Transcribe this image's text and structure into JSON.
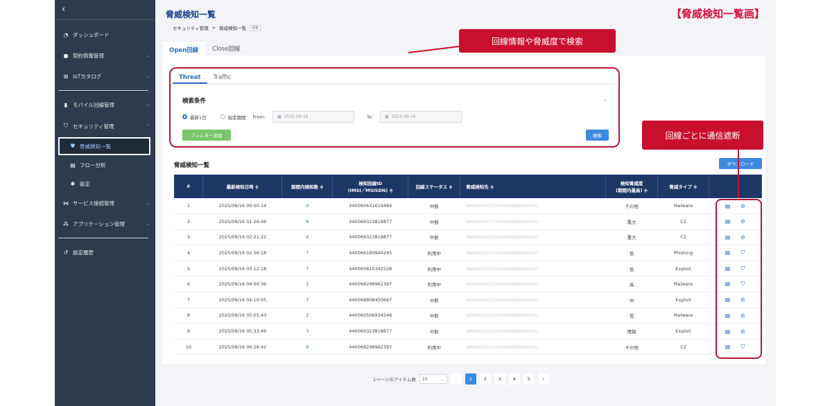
{
  "corner_title": "【脅威検知一覧画】",
  "callouts": {
    "search": "回線情報や脅威度で検索",
    "block": "回線ごとに通信遮断"
  },
  "sidebar": {
    "back": "‹",
    "items": [
      {
        "label": "ダッシュボード"
      },
      {
        "label": "契約情報管理"
      },
      {
        "label": "IoTカタログ"
      },
      {
        "label": "モバイル回線管理"
      },
      {
        "label": "セキュリティ管理"
      },
      {
        "label": "脅威検知一覧"
      },
      {
        "label": "フロー分析"
      },
      {
        "label": "設定"
      },
      {
        "label": "サービス接続管理"
      },
      {
        "label": "アプリケーション管理"
      },
      {
        "label": "設定履歴"
      }
    ]
  },
  "page": {
    "title": "脅威検知一覧",
    "breadcrumb": [
      "セキュリティ管理",
      ">",
      "脅威検知一覧"
    ],
    "breadcrumb_tag": "閲覧",
    "tabs": [
      "Open回線",
      "Close回線"
    ]
  },
  "search": {
    "tabs": [
      "Threat",
      "Traffic"
    ],
    "title": "検索条件",
    "radio1": "最新1日",
    "radio2": "指定期間",
    "from_label": "From:",
    "from_value": "2025-09-16",
    "to_label": "To:",
    "to_value": "2025-09-16",
    "filter_button": "フィルター追加",
    "search_button": "検索"
  },
  "list": {
    "title": "脅威検知一覧",
    "download": "ダウンロード",
    "headers": [
      "#",
      "最新検知日時 ≑",
      "期間内検知数 ≑",
      "検知回線ID\n(IMSI／MSISDN) ≑",
      "回線ステータス ≑",
      "脅威検知先 ≑",
      "検知脅威度\n(期間内最高) ≑",
      "脅威タイプ ≑",
      ""
    ],
    "rows": [
      {
        "no": "1",
        "time": "2025/09/16 00:50:14",
        "count": "0",
        "id": "440060631619484",
        "status": "中断",
        "level": "その他",
        "type": "Malware",
        "blocked": true
      },
      {
        "no": "2",
        "time": "2025/09/16 01:26:06",
        "count": "9",
        "id": "440069323818877",
        "status": "中断",
        "level": "重大",
        "type": "C2",
        "blocked": true
      },
      {
        "no": "3",
        "time": "2025/09/16 02:21:22",
        "count": "4",
        "id": "440069323818877",
        "status": "中断",
        "level": "重大",
        "type": "C2",
        "blocked": true
      },
      {
        "no": "4",
        "time": "2025/09/16 02:56:18",
        "count": "7",
        "id": "440069180944245",
        "status": "利用中",
        "level": "低",
        "type": "Phishing",
        "blocked": false
      },
      {
        "no": "5",
        "time": "2025/09/16 03:12:18",
        "count": "7",
        "id": "440060810342528",
        "status": "利用中",
        "level": "低",
        "type": "Exploit",
        "blocked": false
      },
      {
        "no": "6",
        "time": "2025/09/16 04:00:36",
        "count": "2",
        "id": "440068298962397",
        "status": "利用中",
        "level": "高",
        "type": "Malware",
        "blocked": false
      },
      {
        "no": "7",
        "time": "2025/09/16 04:10:05",
        "count": "7",
        "id": "440068808450667",
        "status": "中断",
        "level": "中",
        "type": "Exploit",
        "blocked": true
      },
      {
        "no": "8",
        "time": "2025/09/16 05:05:43",
        "count": "2",
        "id": "440060506934248",
        "status": "中断",
        "level": "低",
        "type": "Malware",
        "blocked": true
      },
      {
        "no": "9",
        "time": "2025/09/16 05:33:49",
        "count": "3",
        "id": "440069323818877",
        "status": "中断",
        "level": "情報",
        "type": "Exploit",
        "blocked": true
      },
      {
        "no": "10",
        "time": "2025/09/16 06:28:42",
        "count": "0",
        "id": "440068298962397",
        "status": "利用中",
        "level": "その他",
        "type": "C2",
        "blocked": false
      }
    ]
  },
  "pager": {
    "per_page_label": "1ページのアイテム数",
    "per_page": "10",
    "prev": "‹",
    "pages": [
      "1",
      "2",
      "3",
      "4",
      "5"
    ],
    "next": "›"
  }
}
